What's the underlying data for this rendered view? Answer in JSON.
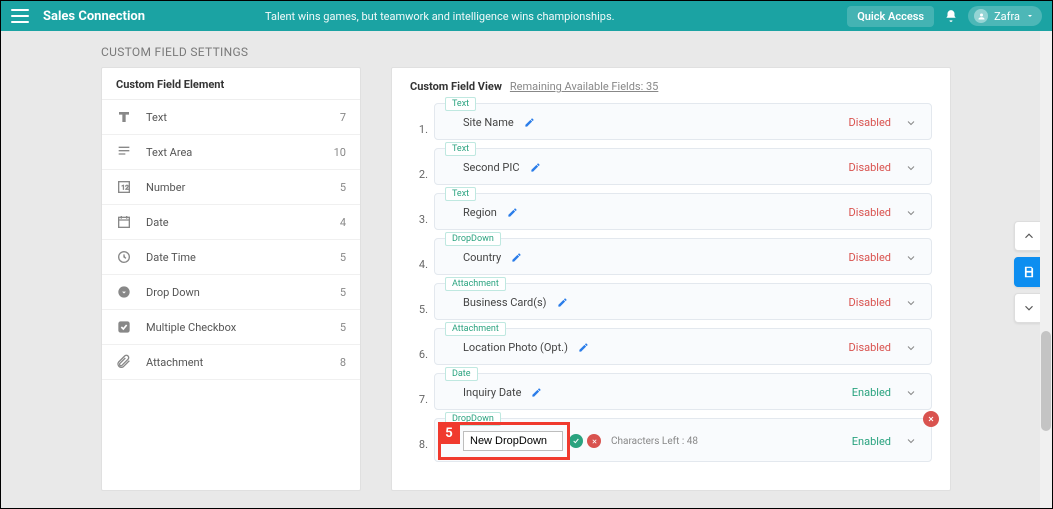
{
  "topbar": {
    "brand": "Sales Connection",
    "tagline": "Talent wins games, but teamwork and intelligence wins championships.",
    "quick_access": "Quick Access",
    "user_name": "Zafra"
  },
  "page": {
    "title": "CUSTOM FIELD SETTINGS"
  },
  "left_panel": {
    "header": "Custom Field Element",
    "items": [
      {
        "icon": "text",
        "label": "Text",
        "count": "7"
      },
      {
        "icon": "textarea",
        "label": "Text Area",
        "count": "10"
      },
      {
        "icon": "number",
        "label": "Number",
        "count": "5"
      },
      {
        "icon": "date",
        "label": "Date",
        "count": "4"
      },
      {
        "icon": "datetime",
        "label": "Date Time",
        "count": "5"
      },
      {
        "icon": "dropdown",
        "label": "Drop Down",
        "count": "5"
      },
      {
        "icon": "checkbox",
        "label": "Multiple Checkbox",
        "count": "5"
      },
      {
        "icon": "attachment",
        "label": "Attachment",
        "count": "8"
      }
    ]
  },
  "right_panel": {
    "title": "Custom Field View",
    "remaining": "Remaining Available Fields: 35",
    "fields": [
      {
        "num": "1.",
        "tag": "Text",
        "name": "Site Name",
        "status": "Disabled",
        "status_kind": "disabled"
      },
      {
        "num": "2.",
        "tag": "Text",
        "name": "Second PIC",
        "status": "Disabled",
        "status_kind": "disabled"
      },
      {
        "num": "3.",
        "tag": "Text",
        "name": "Region",
        "status": "Disabled",
        "status_kind": "disabled"
      },
      {
        "num": "4.",
        "tag": "DropDown",
        "name": "Country",
        "status": "Disabled",
        "status_kind": "disabled"
      },
      {
        "num": "5.",
        "tag": "Attachment",
        "name": "Business Card(s)",
        "status": "Disabled",
        "status_kind": "disabled"
      },
      {
        "num": "6.",
        "tag": "Attachment",
        "name": "Location Photo (Opt.)",
        "status": "Disabled",
        "status_kind": "disabled"
      },
      {
        "num": "7.",
        "tag": "Date",
        "name": "Inquiry Date",
        "status": "Enabled",
        "status_kind": "enabled"
      },
      {
        "num": "8.",
        "tag": "DropDown",
        "name": "New DropDown",
        "status": "Enabled",
        "status_kind": "enabled",
        "editing": true,
        "chars_left": "Characters Left : 48"
      }
    ]
  },
  "callout": {
    "num": "5"
  }
}
